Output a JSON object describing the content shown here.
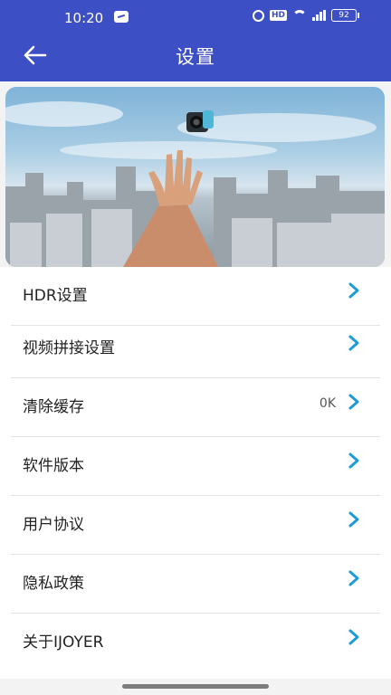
{
  "status_bar": {
    "time": "10:20",
    "hd": "HD",
    "battery": "92",
    "signal_label": "5G"
  },
  "header": {
    "title": "设置",
    "back_icon": "arrow-left-icon",
    "color": "#3d4fc4"
  },
  "menu": {
    "items": [
      {
        "label": "HDR设置",
        "value": ""
      },
      {
        "label": "视频拼接设置",
        "value": ""
      },
      {
        "label": "清除缓存",
        "value": "0K"
      },
      {
        "label": "软件版本",
        "value": ""
      },
      {
        "label": "用户协议",
        "value": ""
      },
      {
        "label": "隐私政策",
        "value": ""
      },
      {
        "label": "关于IJOYER",
        "value": ""
      }
    ],
    "chevron_color": "#1e9bd7",
    "chevron_icon": "chevron-right-icon"
  }
}
